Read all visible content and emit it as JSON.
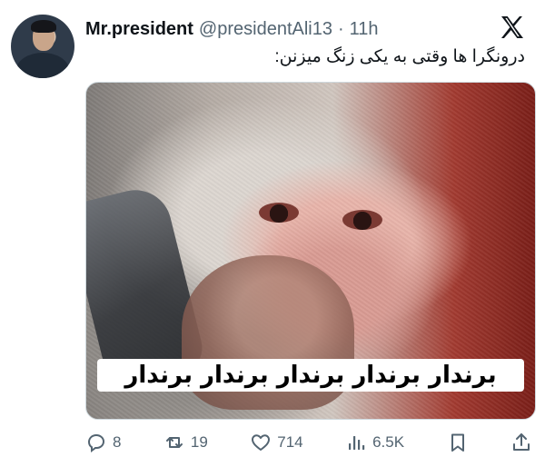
{
  "tweet": {
    "display_name": "Mr.president",
    "handle": "@presidentAli13",
    "separator": "·",
    "time": "11h",
    "text": "درونگرا ها وقتی به یکی زنگ میزنن:"
  },
  "media": {
    "caption": "برندار برندار برندار برندار برندار"
  },
  "actions": {
    "replies": "8",
    "reposts": "19",
    "likes": "714",
    "views": "6.5K"
  },
  "icons": {
    "brand": "x-logo-icon",
    "reply": "reply-icon",
    "repost": "repost-icon",
    "like": "heart-icon",
    "views": "views-icon",
    "bookmark": "bookmark-icon",
    "share": "share-icon"
  },
  "colors": {
    "text": "#0f1419",
    "secondary": "#536471"
  }
}
